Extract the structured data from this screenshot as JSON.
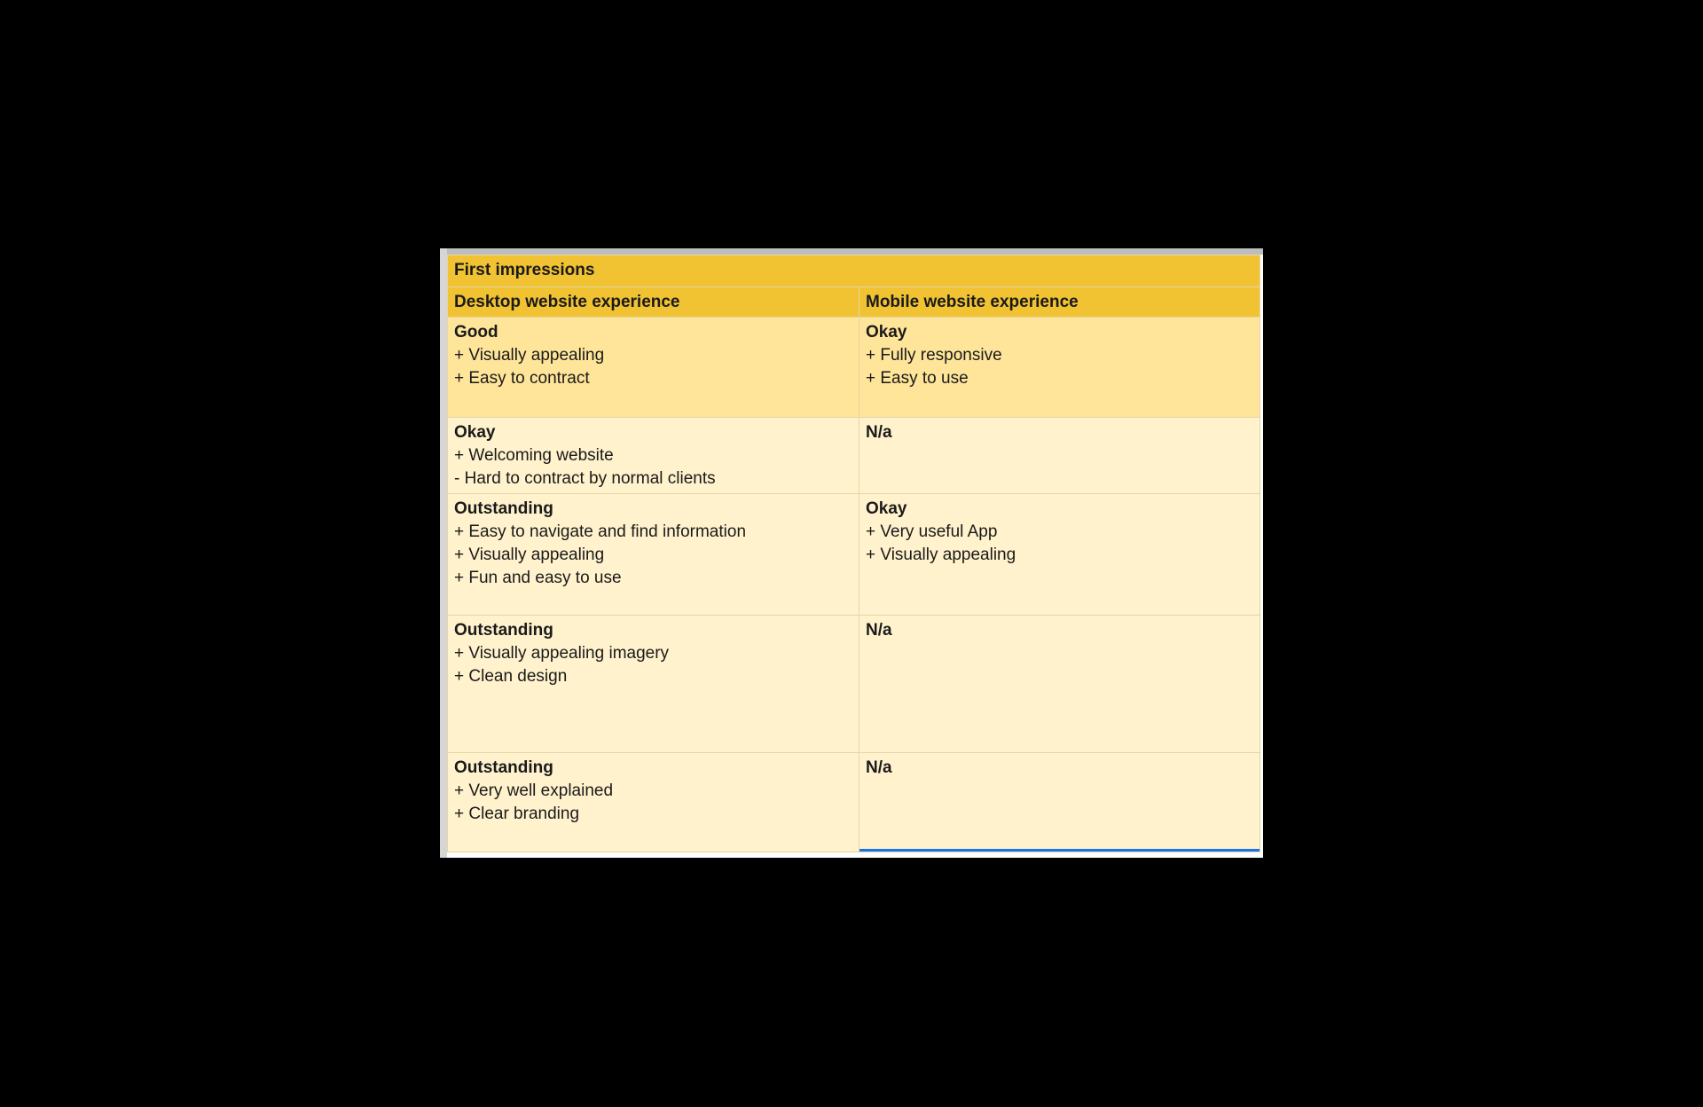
{
  "table": {
    "title": "First impressions",
    "headers": [
      "Desktop website experience",
      "Mobile website experience"
    ],
    "rows": [
      {
        "desktop": {
          "rating": "Good",
          "lines": [
            "+ Visually appealing",
            "+ Easy to contract"
          ]
        },
        "mobile": {
          "rating": "Okay",
          "lines": [
            "+ Fully responsive",
            "+ Easy to use"
          ]
        }
      },
      {
        "desktop": {
          "rating": "Okay",
          "lines": [
            "+ Welcoming website",
            "- Hard to contract by normal clients"
          ]
        },
        "mobile": {
          "rating": "N/a",
          "lines": []
        }
      },
      {
        "desktop": {
          "rating": "Outstanding",
          "lines": [
            "+ Easy to navigate and find information",
            "+ Visually appealing",
            "+ Fun and easy to use"
          ]
        },
        "mobile": {
          "rating": "Okay",
          "lines": [
            "+ Very useful App",
            "+ Visually appealing"
          ]
        }
      },
      {
        "desktop": {
          "rating": "Outstanding",
          "lines": [
            "+ Visually appealing imagery",
            "+ Clean design"
          ]
        },
        "mobile": {
          "rating": "N/a",
          "lines": []
        }
      },
      {
        "desktop": {
          "rating": "Outstanding",
          "lines": [
            "+ Very well explained",
            "+ Clear branding"
          ]
        },
        "mobile": {
          "rating": "N/a",
          "lines": []
        }
      }
    ]
  },
  "colors": {
    "header_fill": "#f1c232",
    "highlight_row_fill": "#ffe599",
    "row_fill": "#fff2cc",
    "selection": "#1a73e8",
    "background": "#000000"
  }
}
